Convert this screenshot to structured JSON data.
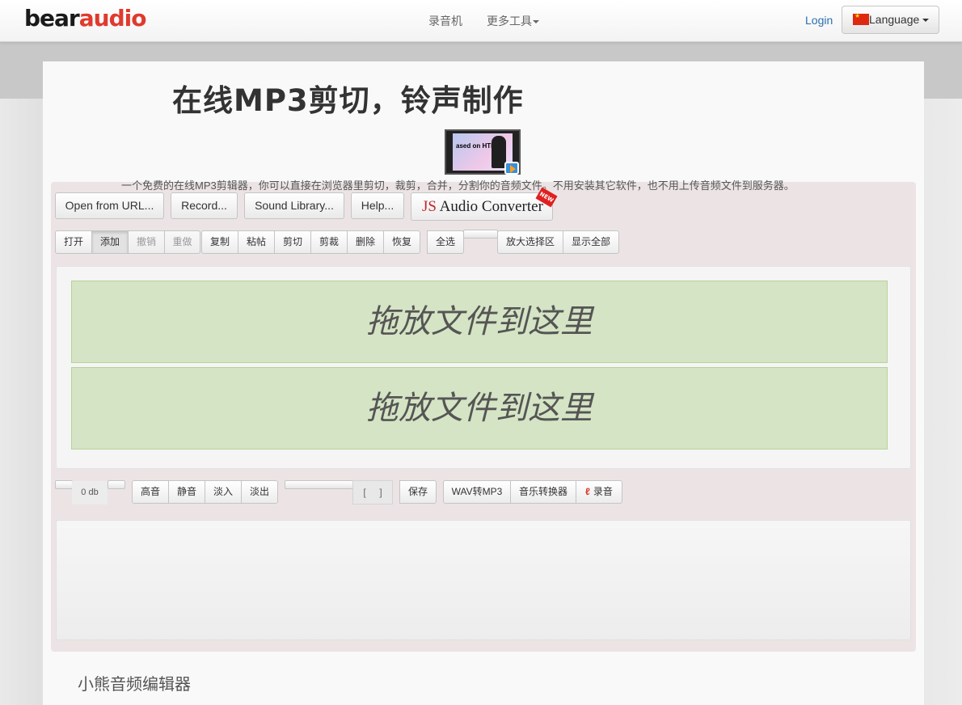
{
  "brand": {
    "part1": "bear",
    "part2": "audio"
  },
  "nav": {
    "recorder": "录音机",
    "more_tools": "更多工具",
    "login": "Login",
    "language": "Language"
  },
  "page": {
    "title": "在线MP3剪切，铃声制作",
    "video_thumb_text": "ased on HTML5",
    "description": "一个免费的在线MP3剪辑器，你可以直接在浏览器里剪切，裁剪，合并，分割你的音频文件。不用安装其它软件，也不用上传音频文件到服务器。"
  },
  "toolbar_top": {
    "open_url": "Open from URL...",
    "record": "Record...",
    "sound_library": "Sound Library...",
    "help": "Help...",
    "js_prefix": "JS",
    "js_converter": "Audio Converter",
    "new_badge": "NEW"
  },
  "toolbar_edit": {
    "open": "打开",
    "add": "添加",
    "undo": "撤销",
    "redo": "重做",
    "copy": "复制",
    "paste": "粘帖",
    "cut": "剪切",
    "crop": "剪裁",
    "delete": "删除",
    "restore": "恢复",
    "select_all": "全选",
    "zoom_selection": "放大选择区",
    "show_all": "显示全部"
  },
  "drop_zone": {
    "text": "拖放文件到这里"
  },
  "toolbar_bottom": {
    "db_value": "0 db",
    "gain": "高音",
    "mute": "静音",
    "fade_in": "淡入",
    "fade_out": "淡出",
    "bracket_open": "[",
    "bracket_close": "]",
    "save": "保存",
    "wav_to_mp3": "WAV转MP3",
    "music_converter": "音乐转换器",
    "record": "录音"
  },
  "footer": {
    "title": "小熊音频编辑器"
  },
  "colors": {
    "brand_red": "#e03a2e",
    "drop_zone_bg": "#d5e4c4",
    "link_blue": "#2a6fb0"
  }
}
